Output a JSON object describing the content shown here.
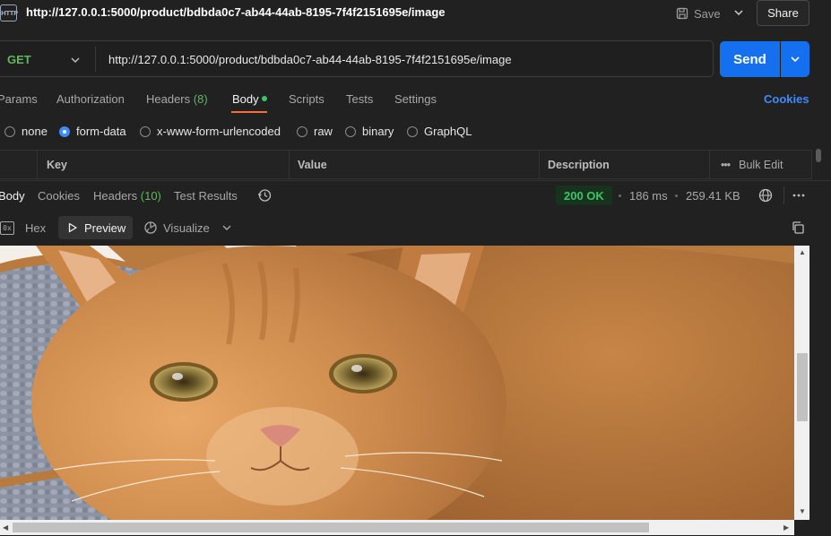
{
  "title_bar": {
    "icon_text": "HTTP",
    "url": "http://127.0.0.1:5000/product/bdbda0c7-ab44-44ab-8195-7f4f2151695e/image",
    "save_label": "Save",
    "share_label": "Share"
  },
  "request": {
    "method": "GET",
    "url": "http://127.0.0.1:5000/product/bdbda0c7-ab44-44ab-8195-7f4f2151695e/image",
    "send_label": "Send"
  },
  "request_tabs": {
    "params": "Params",
    "authorization": "Authorization",
    "headers": "Headers",
    "headers_count": "(8)",
    "body": "Body",
    "scripts": "Scripts",
    "tests": "Tests",
    "settings": "Settings",
    "cookies": "Cookies"
  },
  "body_types": {
    "none": "none",
    "form_data": "form-data",
    "urlencoded": "x-www-form-urlencoded",
    "raw": "raw",
    "binary": "binary",
    "graphql": "GraphQL",
    "selected": "form-data"
  },
  "kv_table": {
    "key": "Key",
    "value": "Value",
    "description": "Description",
    "bulk_edit": "Bulk Edit"
  },
  "response_tabs": {
    "body": "Body",
    "cookies": "Cookies",
    "headers": "Headers",
    "headers_count": "(10)",
    "test_results": "Test Results"
  },
  "response_meta": {
    "status": "200 OK",
    "time": "186 ms",
    "size": "259.41 KB"
  },
  "view_modes": {
    "hex": "Hex",
    "hex_icon_text": "0x",
    "preview": "Preview",
    "visualize": "Visualize"
  },
  "colors": {
    "accent_orange": "#ff6c37",
    "send_blue": "#1570ef",
    "link_blue": "#3d8bfd",
    "status_green": "#3ac569"
  }
}
